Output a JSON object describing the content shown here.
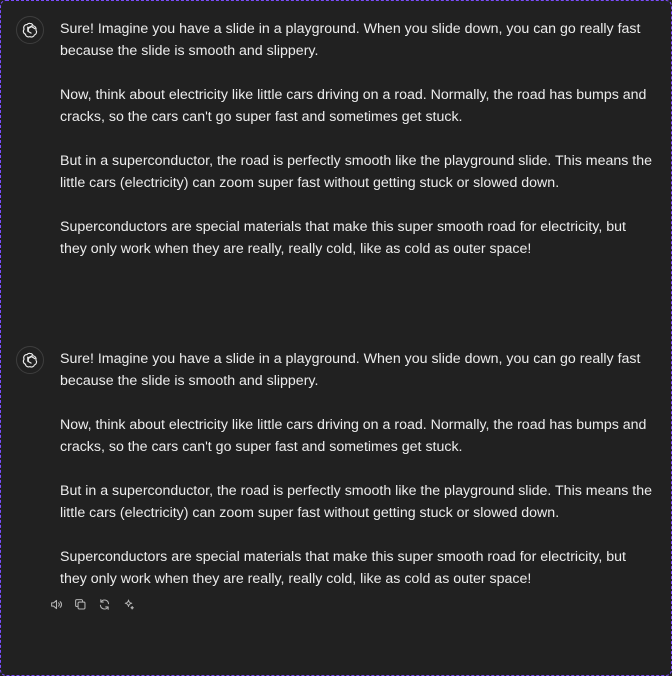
{
  "messages": [
    {
      "paragraphs": [
        "Sure! Imagine you have a slide in a playground. When you slide down, you can go really fast because the slide is smooth and slippery.",
        "Now, think about electricity like little cars driving on a road. Normally, the road has bumps and cracks, so the cars can't go super fast and sometimes get stuck.",
        "But in a superconductor, the road is perfectly smooth like the playground slide. This means the little cars (electricity) can zoom super fast without getting stuck or slowed down.",
        "Superconductors are special materials that make this super smooth road for electricity, but they only work when they are really, really cold, like as cold as outer space!"
      ]
    },
    {
      "paragraphs": [
        "Sure! Imagine you have a slide in a playground. When you slide down, you can go really fast because the slide is smooth and slippery.",
        "Now, think about electricity like little cars driving on a road. Normally, the road has bumps and cracks, so the cars can't go super fast and sometimes get stuck.",
        "But in a superconductor, the road is perfectly smooth like the playground slide. This means the little cars (electricity) can zoom super fast without getting stuck or slowed down.",
        "Superconductors are special materials that make this super smooth road for electricity, but they only work when they are really, really cold, like as cold as outer space!"
      ]
    }
  ],
  "actions": [
    {
      "icon": "speaker-icon"
    },
    {
      "icon": "copy-icon"
    },
    {
      "icon": "regenerate-icon"
    },
    {
      "icon": "sparkle-icon"
    }
  ],
  "colors": {
    "background": "#212121",
    "text": "#ececec",
    "icon": "#b4b4b4",
    "frame": "#7c4dff"
  }
}
